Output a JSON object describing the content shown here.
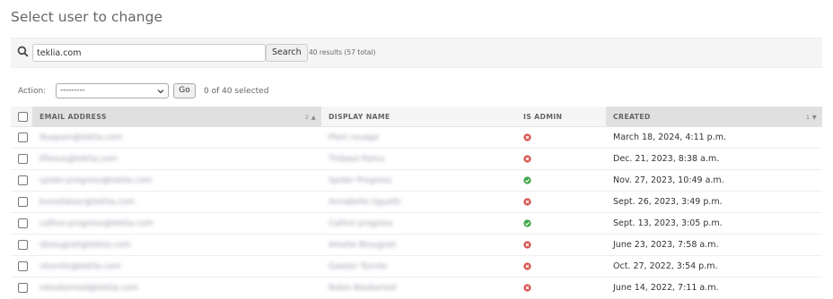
{
  "page": {
    "title": "Select user to change"
  },
  "search": {
    "value": "teklia.com",
    "button_label": "Search",
    "result_count": "40 results (57 total)"
  },
  "actions": {
    "label": "Action:",
    "selected_option": "---------",
    "go_label": "Go",
    "selected_count": "0 of 40 selected"
  },
  "table": {
    "headers": {
      "email": "EMAIL ADDRESS",
      "display_name": "DISPLAY NAME",
      "is_admin": "IS ADMIN",
      "created": "CREATED",
      "email_sort": "2 ▲",
      "created_sort": "1 ▼"
    },
    "rows": [
      {
        "email": "lbuquen@teklia.com",
        "display_name": "Plein rouage",
        "admin": false,
        "created": "March 18, 2024, 4:11 p.m."
      },
      {
        "email": "tflonus@teklia.com",
        "display_name": "Thibaut Ralnu",
        "admin": false,
        "created": "Dec. 21, 2023, 8:38 a.m."
      },
      {
        "email": "spider-progress@teklia.com",
        "display_name": "Spider Progress",
        "admin": true,
        "created": "Nov. 27, 2023, 10:49 a.m."
      },
      {
        "email": "bvoutlaiser@teklia.com",
        "display_name": "Annabelle Ugueth",
        "admin": false,
        "created": "Sept. 26, 2023, 3:49 p.m."
      },
      {
        "email": "callivo-progress@teklia.com",
        "display_name": "Callivo progress",
        "admin": true,
        "created": "Sept. 13, 2023, 3:05 p.m."
      },
      {
        "email": "sbrougnet@teklia.com",
        "display_name": "Amelie Brougnet",
        "admin": false,
        "created": "June 23, 2023, 7:58 a.m."
      },
      {
        "email": "nturnlie@teklia.com",
        "display_name": "Gaetan Turnlie",
        "admin": false,
        "created": "Oct. 27, 2022, 3:54 p.m."
      },
      {
        "email": "rdoudumiod@teklia.com",
        "display_name": "Robin Baubertod",
        "admin": false,
        "created": "June 14, 2022, 7:11 a.m."
      }
    ]
  },
  "colors": {
    "admin_true": "#41a74a",
    "admin_false": "#d9534f",
    "header_bg": "#f5f5f5",
    "sorted_header_bg": "#e0e0e0"
  },
  "icons": {
    "search": "search-icon",
    "admin_yes": "check-circle-icon",
    "admin_no": "cross-circle-icon"
  }
}
